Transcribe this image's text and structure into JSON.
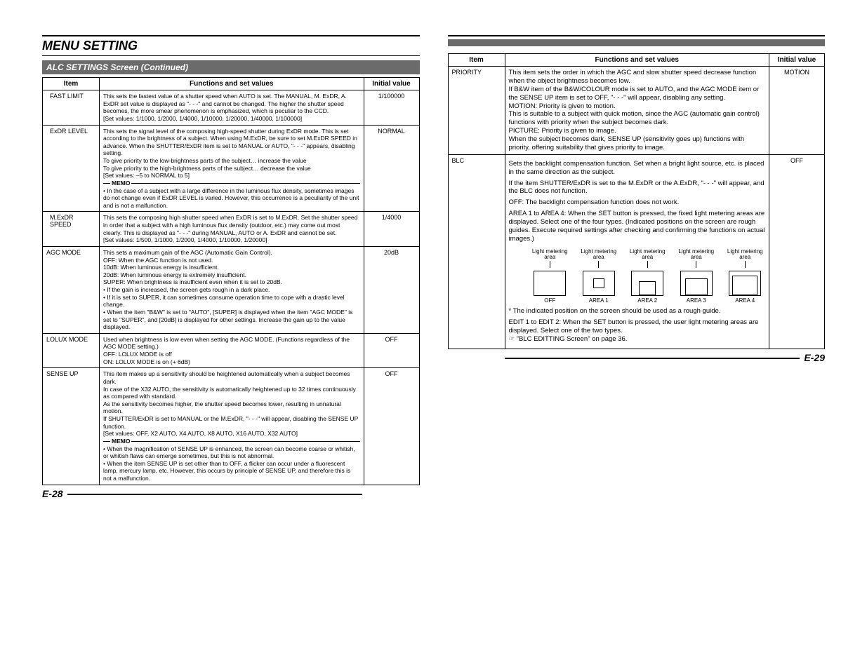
{
  "section_title": "MENU SETTING",
  "subheader": "ALC SETTINGS Screen (Continued)",
  "headers": {
    "item": "Item",
    "functions": "Functions and set values",
    "initial": "Initial value"
  },
  "left_page_num": "E-28",
  "right_page_num": "E-29",
  "left_rows": [
    {
      "item": "FAST LIMIT",
      "init": "1/100000",
      "text": "This sets the fastest value of a shutter speed when AUTO is set. The MANUAL, M. ExDR, A. ExDR set value is displayed as \"- - -\" and cannot be changed. The higher the shutter speed becomes, the more smear phenomenon is emphasized, which is peculiar to the CCD.\n[Set values: 1/1000, 1/2000, 1/4000, 1/10000, 1/20000, 1/40000, 1/100000]"
    },
    {
      "item": "ExDR LEVEL",
      "init": "NORMAL",
      "pre": "This sets the signal level of the composing high-speed shutter during ExDR mode. This is set according to the brightness of a subject. When using M.ExDR, be sure to set M.ExDR SPEED in advance. When the SHUTTER/ExDR item is set to MANUAL or AUTO, \"- - -\" appears, disabling setting.\nTo give priority to the low-brightness parts of the subject… increase the value\nTo give priority to the high-brightness parts of the subject… decrease the value\n[Set values: –5 to NORMAL to 5]",
      "memo_label": "MEMO",
      "memo": "• In the case of a subject with a large difference in the luminous flux density, sometimes images do not change even if ExDR LEVEL is varied. However, this occurrence is a peculiarity of the unit and is not a malfunction."
    },
    {
      "item": "M.ExDR SPEED",
      "init": "1/4000",
      "text": "This sets the composing high shutter speed when ExDR is set to M.ExDR. Set the shutter speed in order that a subject with a high luminous flux density (outdoor, etc.) may come out most clearly. This is displayed as \"- - -\" during MANUAL, AUTO or A. ExDR and cannot be set.\n[Set values: 1/500, 1/1000, 1/2000, 1/4000, 1/10000, 1/20000]"
    },
    {
      "item": "AGC MODE",
      "init": "20dB",
      "text": "This sets a maximum gain of the AGC (Automatic Gain Control).\nOFF:       When the AGC function is not used.\n10dB:      When luminous energy is insufficient.\n20dB:      When luminous energy is extremely insufficient.\nSUPER:  When brightness is insufficient even when it is set to 20dB.\n• If the gain is increased, the screen gets rough in a dark place.\n• If it is set to SUPER, it can sometimes consume operation time to cope with a drastic level change.\n• When the item \"B&W\" is set to \"AUTO\", [SUPER] is displayed when the item \"AGC MODE\" is set to \"SUPER\", and [20dB] is displayed for other settings. Increase the gain up to the value displayed."
    },
    {
      "item": "LOLUX MODE",
      "init": "OFF",
      "text": "Used when brightness is low even when setting the AGC MODE. (Functions regardless of the AGC MODE setting.)\nOFF: LOLUX MODE is off\nON:   LOLUX MODE is on (+ 6dB)"
    },
    {
      "item": "SENSE UP",
      "init": "OFF",
      "pre": "This item makes up a sensitivity should be heightened automatically when a subject becomes dark.\nIn case of the X32 AUTO, the sensitivity is automatically heightened up to 32 times continuously as compared with standard.\nAs the sensitivity becomes higher, the shutter speed becomes lower, resulting in unnatural motion.\nIf SHUTTER/ExDR is set to MANUAL or the M.ExDR, \"- - -\" will appear, disabling the SENSE UP function.\n[Set values: OFF, X2 AUTO, X4 AUTO, X8 AUTO, X16 AUTO, X32 AUTO]",
      "memo_label": "MEMO",
      "memo": "• When the magnification of SENSE UP is enhanced, the screen can become coarse or whitish, or whitish flaws can emerge sometimes, but this is not abnormal.\n• When the item SENSE UP is set other than to OFF, a flicker can occur under a fluorescent lamp, mercury lamp, etc. However, this occurs by principle of SENSE UP, and therefore this is not a malfunction."
    }
  ],
  "right_rows": [
    {
      "item": "PRIORITY",
      "init": "MOTION",
      "text": "This item sets the order in which the AGC and slow shutter speed decrease function when the object brightness becomes low.\nIf B&W item of the B&W/COLOUR mode is set to AUTO, and the AGC MODE item or the SENSE UP item is set to OFF, \"- - -\" will appear, disabling any setting.\nMOTION:   Priority is given to motion.\n                    This is suitable to a subject with quick motion, since the AGC (automatic gain control) functions with priority when the subject becomes dark.\nPICTURE: Priority is given to image.\n                    When the subject becomes dark, SENSE UP (sensitivity goes up) functions with priority, offering suitability that gives priority to image."
    },
    {
      "item": "BLC",
      "init": "OFF",
      "p1": "Sets the backlight compensation function. Set when a bright light source, etc. is placed in the same direction as the subject.",
      "p2": "If the item SHUTTER/ExDR is set to the M.ExDR or the A.ExDR, \"- - -\" will appear, and the BLC does not function.",
      "p3": "OFF: The backlight compensation function does not work.",
      "p4": "AREA 1 to AREA 4: When the SET button is pressed, the fixed light metering areas are displayed. Select one of the four types. (Indicated positions on the screen are rough guides. Execute required settings after checking and confirming the functions on actual images.)",
      "diag_label_top": "Light metering area",
      "diag_labels": [
        "OFF",
        "AREA 1",
        "AREA 2",
        "AREA 3",
        "AREA 4"
      ],
      "p5": "* The indicated position on the screen should be used as a rough guide.",
      "p6": "EDIT 1 to EDIT 2: When the SET button is pressed, the user light metering areas are displayed. Select one of the two types.\n☞ \"BLC EDITTING Screen\" on page 36."
    }
  ]
}
